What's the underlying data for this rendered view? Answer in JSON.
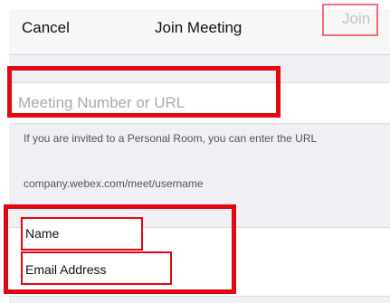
{
  "navbar": {
    "cancel_label": "Cancel",
    "title": "Join Meeting",
    "join_label": "Join"
  },
  "meeting_input": {
    "placeholder": "Meeting Number or URL",
    "value": ""
  },
  "hint": {
    "text": "If you are invited to a Personal Room, you can enter the URL",
    "example_url": "company.webex.com/meet/username"
  },
  "fields": {
    "name_label": "Name",
    "email_label": "Email Address"
  },
  "colors": {
    "highlight": "#e30613",
    "join_disabled": "#c2c2c2",
    "background": "#efeff4"
  }
}
